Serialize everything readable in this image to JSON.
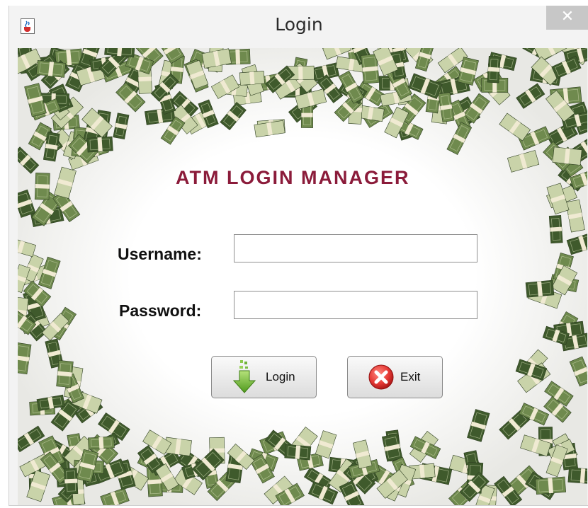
{
  "window": {
    "title": "Login",
    "close_label": "✕",
    "app_icon": "java-cup-icon"
  },
  "login_form": {
    "heading": "ATM LOGIN MANAGER",
    "username_label": "Username:",
    "username_value": "",
    "password_label": "Password:",
    "password_value": "",
    "login_button": "Login",
    "login_icon": "green-down-arrow-icon",
    "exit_button": "Exit",
    "exit_icon": "red-x-circle-icon"
  },
  "background": {
    "description": "",
    "colors": {
      "cash_dark": "#3f5a2c",
      "cash_mid": "#6f8a4e",
      "cash_light": "#c9d3a9",
      "band": "#f0ead2",
      "center": "#fafafa"
    }
  },
  "colors": {
    "heading": "#8b1b3a",
    "close_bg": "#c7c7c7",
    "title_bg": "#f3f3f3"
  }
}
